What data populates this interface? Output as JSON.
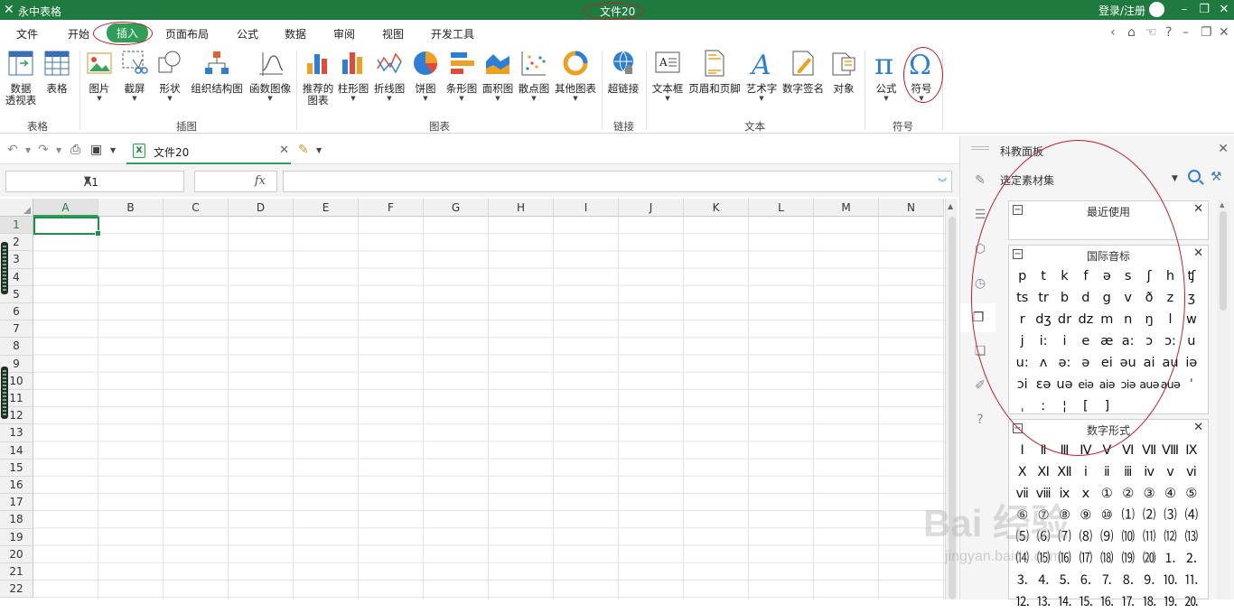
{
  "app": {
    "name": "永中表格",
    "document_title": "文件20",
    "login": "登录/注册"
  },
  "menu": [
    "文件",
    "开始",
    "插入",
    "页面布局",
    "公式",
    "数据",
    "审阅",
    "视图",
    "开发工具"
  ],
  "ribbon": {
    "buttons": [
      {
        "label": "数据\n透视表",
        "icon": "pivot-table-icon"
      },
      {
        "label": "表格",
        "icon": "table-icon"
      },
      {
        "label": "图片",
        "icon": "picture-icon"
      },
      {
        "label": "截屏",
        "icon": "screenshot-icon"
      },
      {
        "label": "形状",
        "icon": "shape-icon"
      },
      {
        "label": "组织结构图",
        "icon": "org-chart-icon"
      },
      {
        "label": "函数图像",
        "icon": "function-graph-icon"
      },
      {
        "label": "推荐的\n图表",
        "icon": "recommended-chart-icon"
      },
      {
        "label": "柱形图",
        "icon": "column-chart-icon"
      },
      {
        "label": "折线图",
        "icon": "line-chart-icon"
      },
      {
        "label": "饼图",
        "icon": "pie-chart-icon"
      },
      {
        "label": "条形图",
        "icon": "bar-chart-icon"
      },
      {
        "label": "面积图",
        "icon": "area-chart-icon"
      },
      {
        "label": "散点图",
        "icon": "scatter-chart-icon"
      },
      {
        "label": "其他图表",
        "icon": "other-chart-icon"
      },
      {
        "label": "超链接",
        "icon": "hyperlink-icon"
      },
      {
        "label": "文本框",
        "icon": "textbox-icon"
      },
      {
        "label": "页眉和页脚",
        "icon": "header-footer-icon"
      },
      {
        "label": "艺术字",
        "icon": "wordart-icon"
      },
      {
        "label": "数字签名",
        "icon": "digital-signature-icon"
      },
      {
        "label": "对象",
        "icon": "object-icon"
      },
      {
        "label": "公式",
        "icon": "equation-icon"
      },
      {
        "label": "符号",
        "icon": "symbol-icon"
      }
    ],
    "groups": [
      "表格",
      "插图",
      "图表",
      "链接",
      "文本",
      "符号"
    ]
  },
  "doc_tab": {
    "name": "文件20"
  },
  "formula_bar": {
    "cell_ref": "A1",
    "fx": "fx",
    "value": ""
  },
  "grid": {
    "columns": [
      "A",
      "B",
      "C",
      "D",
      "E",
      "F",
      "G",
      "H",
      "I",
      "J",
      "K",
      "L",
      "M",
      "N"
    ],
    "rows": [
      "1",
      "2",
      "3",
      "4",
      "5",
      "6",
      "7",
      "8",
      "9",
      "10",
      "11",
      "12",
      "13",
      "14",
      "15",
      "16",
      "17",
      "18",
      "19",
      "20",
      "21",
      "22"
    ]
  },
  "panel": {
    "title": "科教面板",
    "selector": "选定素材集",
    "sections": [
      {
        "title": "最近使用",
        "symbols": []
      },
      {
        "title": "国际音标",
        "symbols": [
          "p",
          "t",
          "k",
          "f",
          "ə",
          "s",
          "ʃ",
          "h",
          "ʧ",
          "ts",
          "tr",
          "b",
          "d",
          "g",
          "v",
          "ð",
          "z",
          "ʒ",
          "r",
          "dʒ",
          "dr",
          "dz",
          "m",
          "n",
          "ŋ",
          "l",
          "w",
          "j",
          "i:",
          "i",
          "e",
          "æ",
          "a:",
          "ɔ",
          "ɔ:",
          "u",
          "u:",
          "ʌ",
          "ə:",
          "ə",
          "ei",
          "əu",
          "ai",
          "au",
          "iə",
          "ɔi",
          "ɛə",
          "uə",
          "eiə",
          "aiə",
          "ɔiə",
          "auə",
          "auə",
          "ˈ",
          "ˌ",
          "ː",
          "¦",
          "[",
          "]"
        ]
      },
      {
        "title": "数字形式",
        "symbols": [
          "Ⅰ",
          "Ⅱ",
          "Ⅲ",
          "Ⅳ",
          "Ⅴ",
          "Ⅵ",
          "Ⅶ",
          "Ⅷ",
          "Ⅸ",
          "Ⅹ",
          "Ⅺ",
          "Ⅻ",
          "ⅰ",
          "ⅱ",
          "ⅲ",
          "ⅳ",
          "ⅴ",
          "ⅵ",
          "ⅶ",
          "ⅷ",
          "ⅸ",
          "ⅹ",
          "①",
          "②",
          "③",
          "④",
          "⑤",
          "⑥",
          "⑦",
          "⑧",
          "⑨",
          "⑩",
          "⑴",
          "⑵",
          "⑶",
          "⑷",
          "⑸",
          "⑹",
          "⑺",
          "⑻",
          "⑼",
          "⑽",
          "⑾",
          "⑿",
          "⒀",
          "⒁",
          "⒂",
          "⒃",
          "⒄",
          "⒅",
          "⒆",
          "⒇",
          "⒈",
          "⒉",
          "⒊",
          "⒋",
          "⒌",
          "⒍",
          "⒎",
          "⒏",
          "⒐",
          "⒑",
          "⒒",
          "⒓",
          "⒔",
          "⒕",
          "⒖",
          "⒗",
          "⒘",
          "⒙",
          "⒚",
          "⒛"
        ]
      }
    ]
  },
  "watermark": {
    "main": "Bai 经验",
    "sub": "jingyan.baidu.com"
  },
  "colors": {
    "brand": "#1e7a3e",
    "accent": "#2f9e57",
    "annotation": "#c0202a"
  }
}
